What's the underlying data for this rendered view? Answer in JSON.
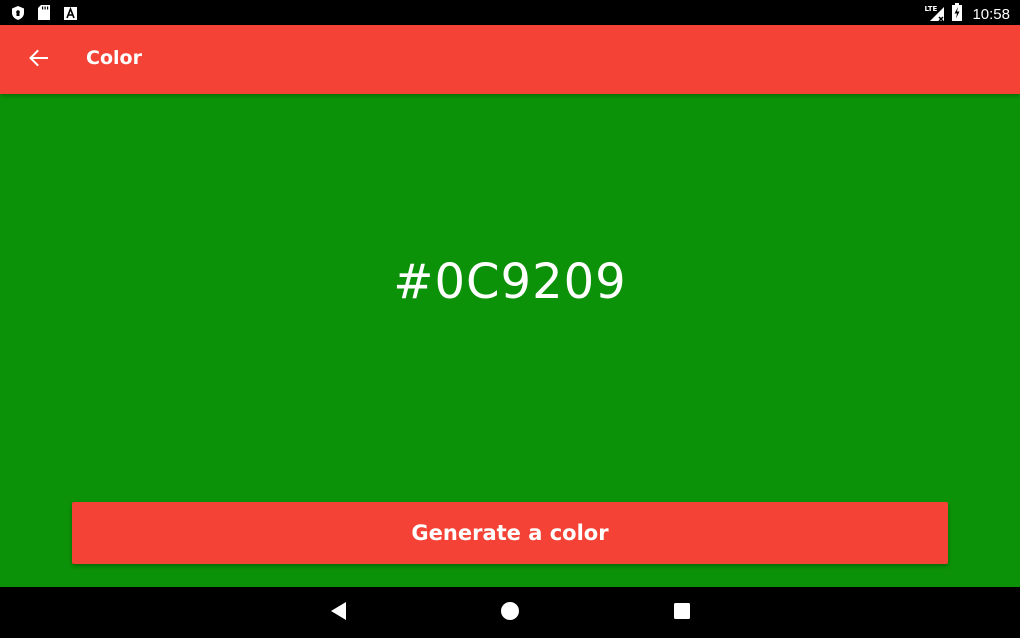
{
  "status_bar": {
    "time": "10:58",
    "network": "LTE",
    "icons": [
      "shield-icon",
      "sd-card-icon",
      "font-a-icon",
      "signal-icon",
      "battery-charging-icon"
    ]
  },
  "app_bar": {
    "title": "Color",
    "back_icon": "arrow-left-icon"
  },
  "main": {
    "hex_value": "#0C9209",
    "background_color": "#0C9209",
    "generate_button_label": "Generate a color"
  },
  "colors": {
    "accent": "#f44336"
  },
  "nav_bar": {
    "buttons": [
      "back-triangle-icon",
      "home-circle-icon",
      "recents-square-icon"
    ]
  }
}
